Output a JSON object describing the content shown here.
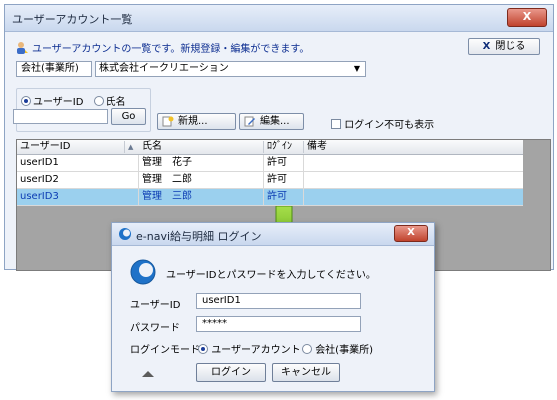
{
  "window": {
    "title": "ユーザーアカウント一覧",
    "close_glyph": "X"
  },
  "info": {
    "message": "ユーザーアカウントの一覧です。新規登録・編集ができます。"
  },
  "close_button": {
    "label": "閉じる",
    "glyph": "X"
  },
  "company": {
    "label": "会社(事業所)",
    "value": "株式会社イークリエーション",
    "arrow": "▼"
  },
  "search": {
    "radio_userid": "ユーザーID",
    "radio_name": "氏名",
    "selected": "userid",
    "go_label": "Go",
    "input_value": ""
  },
  "toolbar": {
    "new_label": "新規...",
    "edit_label": "編集...",
    "show_disabled_label": "ログイン不可も表示"
  },
  "grid": {
    "columns": [
      "ユーザーID",
      "▲",
      "氏名",
      "ﾛｸﾞｲﾝ",
      "備考"
    ],
    "rows": [
      {
        "id": "userID1",
        "name": "管理　花子",
        "login": "許可",
        "note": ""
      },
      {
        "id": "userID2",
        "name": "管理　二郎",
        "login": "許可",
        "note": ""
      },
      {
        "id": "userID3",
        "name": "管理　三郎",
        "login": "許可",
        "note": ""
      }
    ],
    "selected_row": 2
  },
  "dialog": {
    "title": "e-navi給与明細 ログイン",
    "close_glyph": "X",
    "message": "ユーザーIDとパスワードを入力してください。",
    "userid_label": "ユーザーID",
    "userid_value": "userID1",
    "password_label": "パスワード",
    "password_value": "*****",
    "mode_label": "ログインモード",
    "mode_user": "ユーザーアカウント",
    "mode_company": "会社(事業所)",
    "login_button": "ログイン",
    "cancel_button": "キャンセル"
  },
  "colors": {
    "accent_text": "#0d2e91",
    "selected_row": "#9bd0ee",
    "arrow": "#7ac21f",
    "close_red": "#c0432d"
  }
}
